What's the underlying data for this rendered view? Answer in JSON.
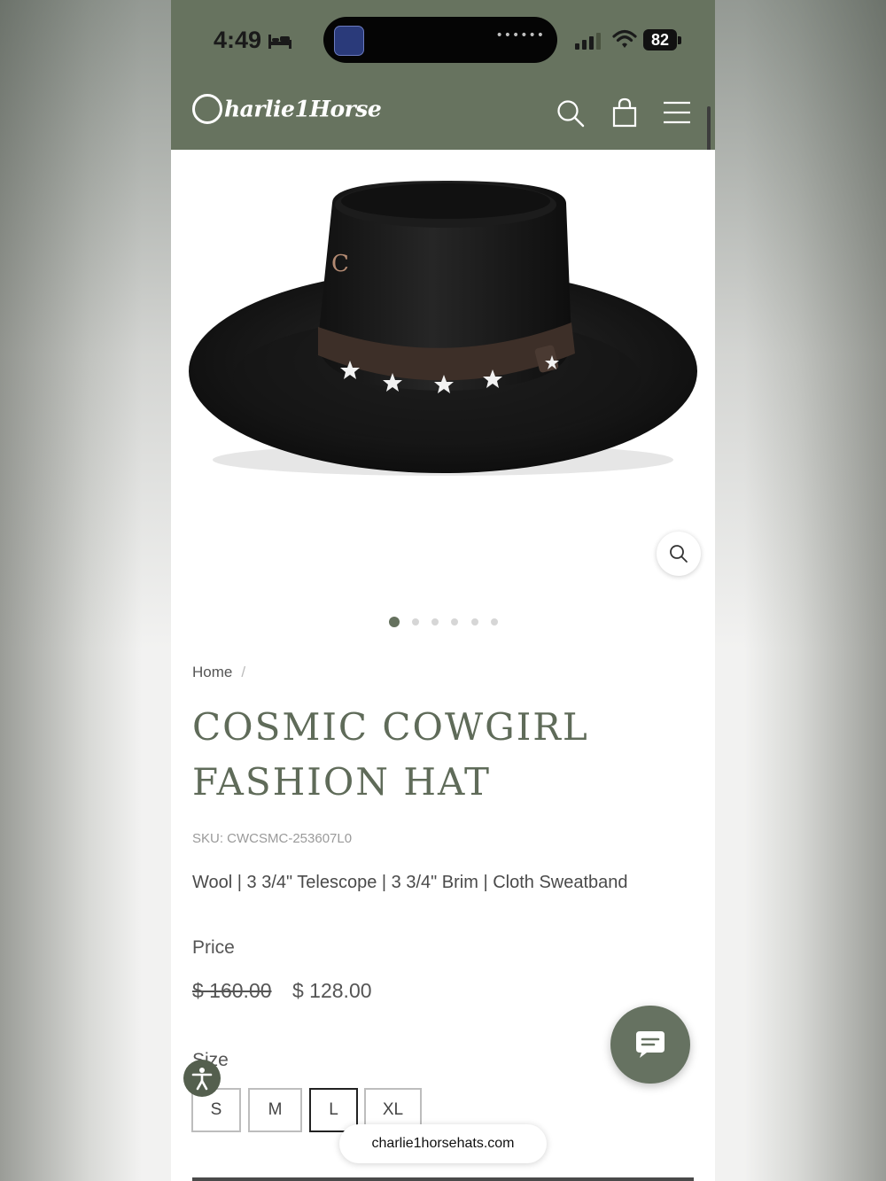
{
  "status_bar": {
    "time": "4:49",
    "battery": "82",
    "island_dots": "••••••"
  },
  "header": {
    "logo_text": "harlie1Horse",
    "icons": [
      "search-icon",
      "cart-icon",
      "menu-icon"
    ]
  },
  "gallery": {
    "image_count": 6,
    "active_index": 0
  },
  "breadcrumb": {
    "home": "Home",
    "separator": "/"
  },
  "product": {
    "title": "COSMIC COWGIRL FASHION HAT",
    "sku": "SKU: CWCSMC-253607L0",
    "description": "Wool | 3 3/4\" Telescope | 3 3/4\" Brim | Cloth Sweatband",
    "price_label": "Price",
    "original_price": "$ 160.00",
    "sale_price": "$ 128.00",
    "size_label": "Size",
    "sizes": [
      "S",
      "M",
      "L",
      "XL"
    ],
    "selected_size": "L"
  },
  "browser": {
    "url": "charlie1horsehats.com"
  },
  "colors": {
    "brand_green": "#67735f",
    "title_green": "#5f6b59"
  }
}
